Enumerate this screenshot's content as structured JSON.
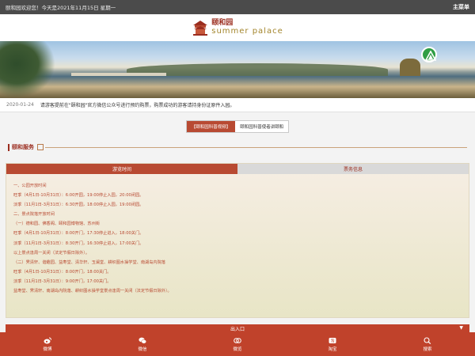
{
  "topbar": {
    "welcome": "颐和园欢迎您！今天是2021年11月15日  星期一",
    "menu": "主菜单"
  },
  "header": {
    "logo_cn": "颐和园",
    "logo_en": "summer  palace"
  },
  "notice": {
    "date": "2020-01-24",
    "text": "请游客提前在\"颐和园\"官方微信公众号进行预约购票，购票成功的游客请持身份证原件入园。"
  },
  "tabs": [
    "【颐和园科普视频】",
    "颐和园科普使者讲颐和"
  ],
  "section": {
    "title": "颐和服务"
  },
  "panel": {
    "tab_active": "游览时间",
    "tab_inactive": "票务信息",
    "lines": [
      "一、公园开放时间",
      "旺季（4月1日-10月31日）：6:00开园，19:00停止入园，20:00闭园。",
      "淡季（11月1日-3月31日）：6:30开园，18:00停止入园，19:00闭园。",
      "二、景点院落开放时间",
      "（一）德和园、佛香阁、颐和园博物馆、苏州街",
      "旺季（4月1日-10月31日）：8:00开门，17:30停止进入，18:00关门。",
      "淡季（11月1日-3月31日）：8:30开门，16:30停止进入，17:00关门。",
      "以上景点逢周一关闭（法定节假日除外）。",
      "（二）霁清轩、谐趣园、益寿堂、清华轩、玉澜堂、耕织图水操学堂、南湖岛内院落",
      "旺季（4月1日-10月31日）：8:00开门，18:00关门。",
      "淡季（11月1日-3月31日）：9:00开门，17:00关门。",
      "益寿堂、霁清轩、南湖岛内院落、耕织图水操学堂景点逢周一关闭（法定节假日除外）。"
    ]
  },
  "entry": {
    "label": "出入口"
  },
  "nav": [
    {
      "label": "微博",
      "icon": "weibo-icon"
    },
    {
      "label": "微信",
      "icon": "wechat-icon"
    },
    {
      "label": "微览",
      "icon": "weilan-icon"
    },
    {
      "label": "淘宝",
      "icon": "taobao-icon"
    },
    {
      "label": "搜索",
      "icon": "search-icon"
    }
  ],
  "colors": {
    "accent": "#c0422b",
    "brand": "#9b2d1f",
    "topbar": "#4b4b4b"
  }
}
